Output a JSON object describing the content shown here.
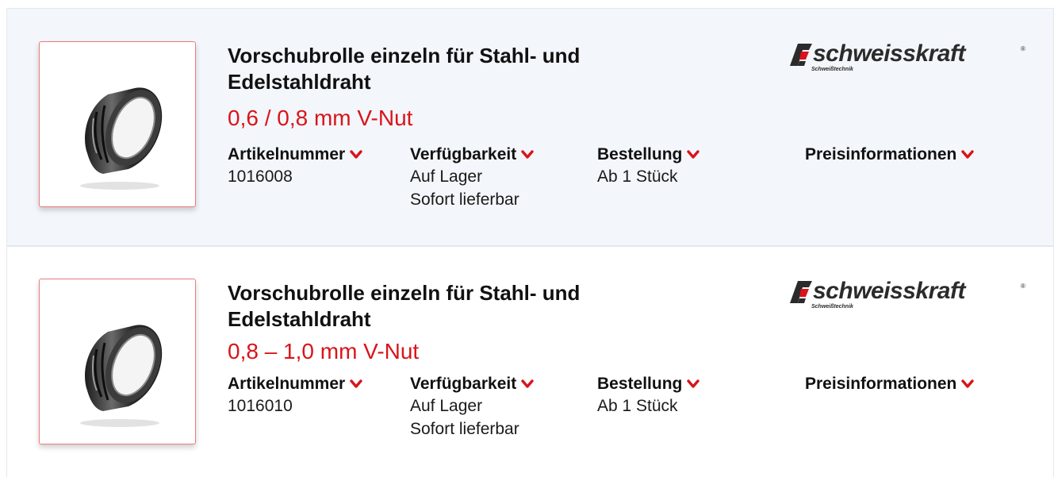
{
  "products": [
    {
      "title": "Vorschubrolle einzeln für Stahl- und Edelstahldraht",
      "subtitle": "0,6 / 0,8 mm V-Nut",
      "brand": {
        "name": "schweisskraft",
        "registered": "®",
        "tagline": "Schweißtechnik"
      },
      "article_label": "Artikelnummer",
      "article_number": "1016008",
      "availability_label": "Verfügbarkeit",
      "availability_line1": "Auf Lager",
      "availability_line2": "Sofort lieferbar",
      "order_label": "Bestellung",
      "order_value": "Ab 1 Stück",
      "price_label": "Preisinformationen"
    },
    {
      "title": "Vorschubrolle einzeln für Stahl- und Edelstahldraht",
      "subtitle": "0,8 – 1,0 mm V-Nut",
      "brand": {
        "name": "schweisskraft",
        "registered": "®",
        "tagline": "Schweißtechnik"
      },
      "article_label": "Artikelnummer",
      "article_number": "1016010",
      "availability_label": "Verfügbarkeit",
      "availability_line1": "Auf Lager",
      "availability_line2": "Sofort lieferbar",
      "order_label": "Bestellung",
      "order_value": "Ab 1 Stück",
      "price_label": "Preisinformationen"
    }
  ],
  "icons": {
    "expand": "chevron-down-icon",
    "product_image": "feed-roller-image",
    "brand_logo": "schweisskraft-logo"
  },
  "colors": {
    "accent_red": "#d9141b",
    "card_bg": "#f3f6fa",
    "thumb_border": "#f07a7a"
  }
}
